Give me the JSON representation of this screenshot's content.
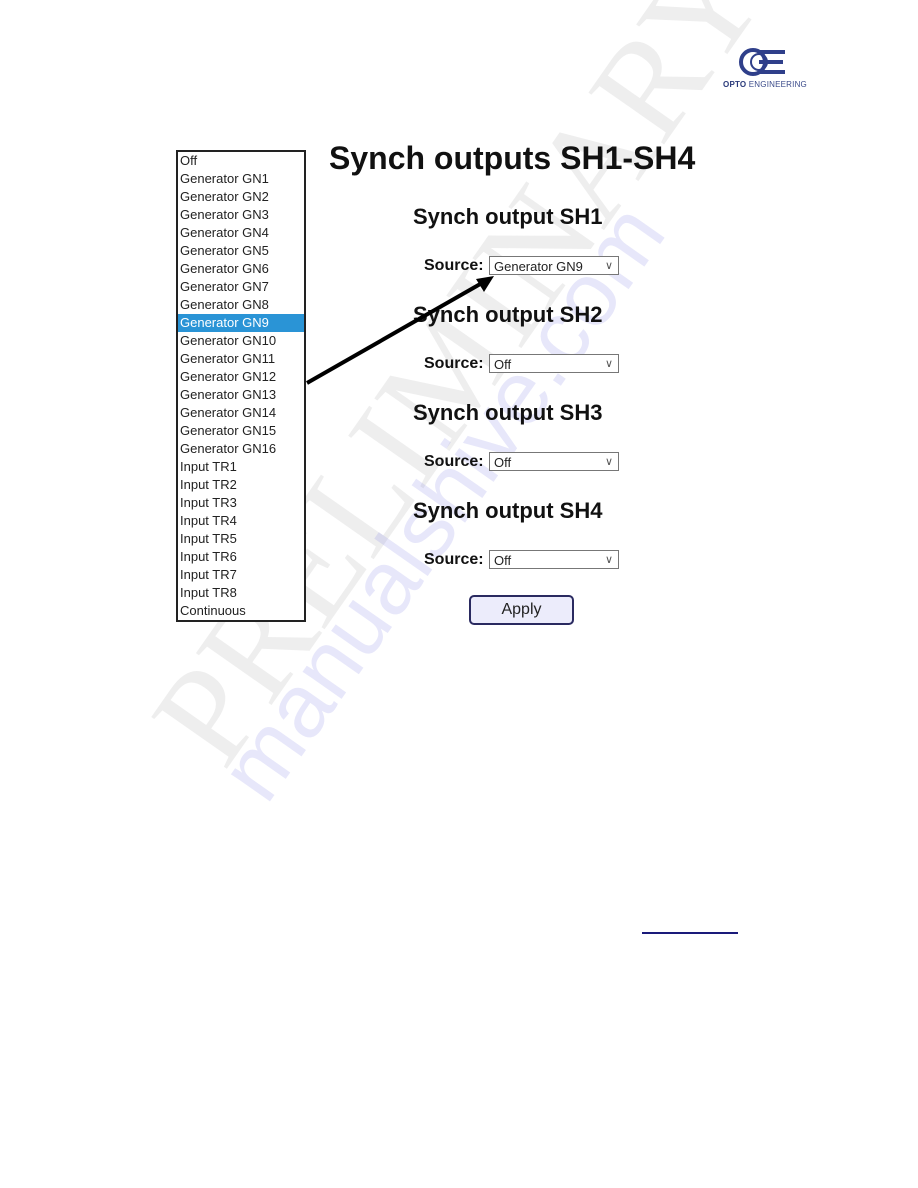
{
  "brand": {
    "name_bold": "OPTO",
    "name_rest": " ENGINEERING"
  },
  "dropdown_list": {
    "options": [
      "Off",
      "Generator GN1",
      "Generator GN2",
      "Generator GN3",
      "Generator GN4",
      "Generator GN5",
      "Generator GN6",
      "Generator GN7",
      "Generator GN8",
      "Generator GN9",
      "Generator GN10",
      "Generator GN11",
      "Generator GN12",
      "Generator GN13",
      "Generator GN14",
      "Generator GN15",
      "Generator GN16",
      "Input TR1",
      "Input TR2",
      "Input TR3",
      "Input TR4",
      "Input TR5",
      "Input TR6",
      "Input TR7",
      "Input TR8",
      "Continuous"
    ],
    "selected": "Generator GN9",
    "highlight_color": "#2a94d6"
  },
  "page": {
    "title": "Synch outputs SH1-SH4",
    "source_label": "Source:",
    "outputs": [
      {
        "heading": "Synch output SH1",
        "source": "Generator GN9"
      },
      {
        "heading": "Synch output SH2",
        "source": "Off"
      },
      {
        "heading": "Synch output SH3",
        "source": "Off"
      },
      {
        "heading": "Synch output SH4",
        "source": "Off"
      }
    ],
    "apply_label": "Apply"
  },
  "watermark": {
    "text1": "PRELIMINARY",
    "text2": "manualshive.com"
  }
}
